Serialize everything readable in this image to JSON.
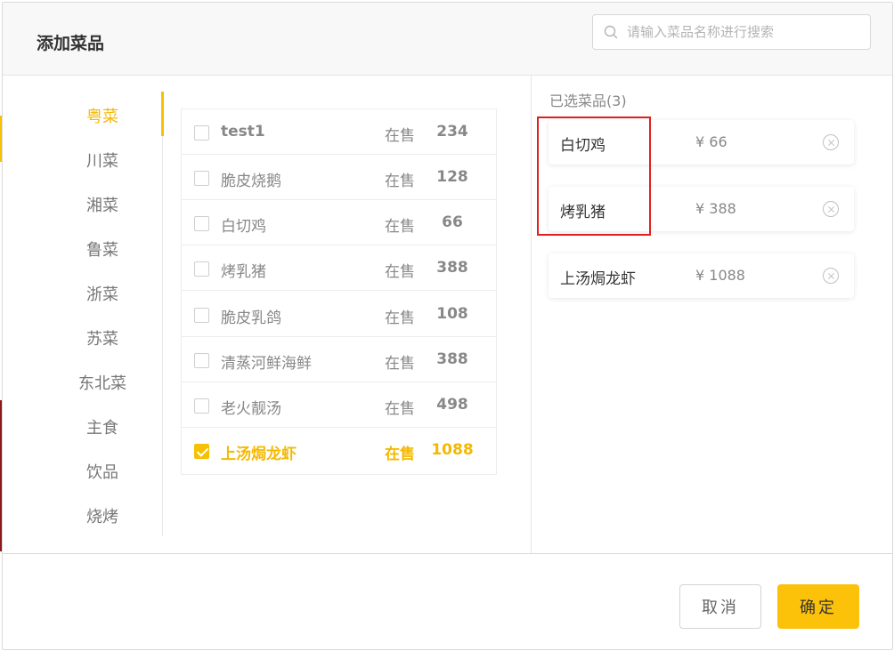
{
  "dialog": {
    "title": "添加菜品",
    "search_placeholder": "请输入菜品名称进行搜索"
  },
  "categories": [
    {
      "label": "粤菜",
      "active": true
    },
    {
      "label": "川菜"
    },
    {
      "label": "湘菜"
    },
    {
      "label": "鲁菜"
    },
    {
      "label": "浙菜"
    },
    {
      "label": "苏菜"
    },
    {
      "label": "东北菜"
    },
    {
      "label": "主食"
    },
    {
      "label": "饮品"
    },
    {
      "label": "烧烤"
    }
  ],
  "dishes": [
    {
      "name": "test1",
      "status": "在售",
      "price": "234",
      "checked": false
    },
    {
      "name": "脆皮烧鹅",
      "status": "在售",
      "price": "128",
      "checked": false
    },
    {
      "name": "白切鸡",
      "status": "在售",
      "price": "66",
      "checked": false
    },
    {
      "name": "烤乳猪",
      "status": "在售",
      "price": "388",
      "checked": false
    },
    {
      "name": "脆皮乳鸽",
      "status": "在售",
      "price": "108",
      "checked": false
    },
    {
      "name": "清蒸河鲜海鲜",
      "status": "在售",
      "price": "388",
      "checked": false
    },
    {
      "name": "老火靓汤",
      "status": "在售",
      "price": "498",
      "checked": false
    },
    {
      "name": "上汤焗龙虾",
      "status": "在售",
      "price": "1088",
      "checked": true
    }
  ],
  "selected": {
    "heading": "已选菜品(3)",
    "items": [
      {
        "name": "白切鸡",
        "price": "¥ 66"
      },
      {
        "name": "烤乳猪",
        "price": "¥ 388"
      },
      {
        "name": "上汤焗龙虾",
        "price": "¥ 1088"
      }
    ]
  },
  "footer": {
    "cancel_label": "取消",
    "confirm_label": "确定"
  },
  "colors": {
    "accent": "#f5c100",
    "highlight": "#e02020"
  }
}
